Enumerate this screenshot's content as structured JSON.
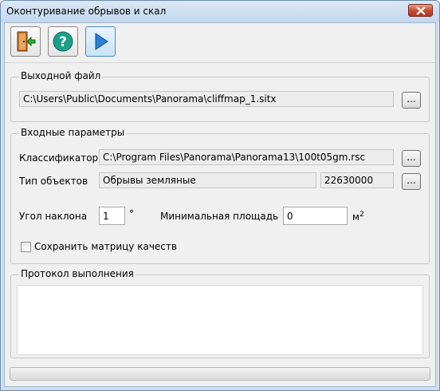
{
  "window": {
    "title": "Оконтуривание обрывов и скал"
  },
  "toolbar": {
    "exit_icon": "exit-door-icon",
    "help_icon": "help-question-icon",
    "run_icon": "run-play-icon"
  },
  "output": {
    "legend": "Выходной файл",
    "path": "C:\\Users\\Public\\Documents\\Panorama\\cliffmap_1.sitx",
    "browse_label": "..."
  },
  "input": {
    "legend": "Входные параметры",
    "classifier_label": "Классификатор",
    "classifier_path": "C:\\Program Files\\Panorama\\Panorama13\\100t05gm.rsc",
    "classifier_browse": "...",
    "objtype_label": "Тип объектов",
    "objtype_name": "Обрывы земляные",
    "objtype_code": "22630000",
    "objtype_browse": "...",
    "slope_label": "Угол наклона",
    "slope_value": "1",
    "slope_unit": "°",
    "minarea_label": "Минимальная площадь",
    "minarea_value": "0",
    "minarea_unit": "м",
    "minarea_unit_sup": "2",
    "save_matrix_label": "Сохранить матрицу качеств",
    "save_matrix_checked": false
  },
  "log": {
    "legend": "Протокол выполнения",
    "text": ""
  },
  "progress": {
    "value": 0
  },
  "colors": {
    "accent": "#4a86c8",
    "close": "#c44a30",
    "help": "#1aa08a"
  }
}
